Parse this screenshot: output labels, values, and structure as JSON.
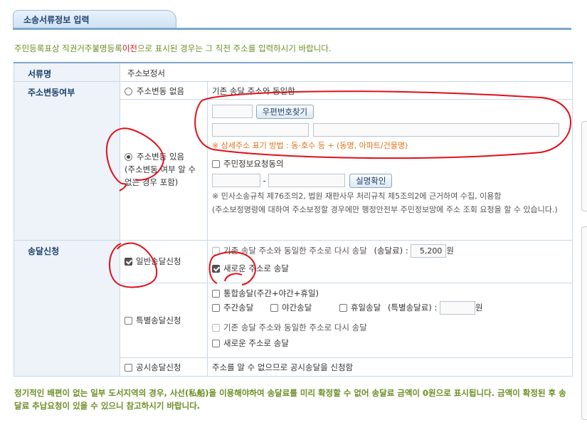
{
  "section_tab": "소송서류정보 입력",
  "notice": {
    "pre": "주민등록표상 직권거주불명등록",
    "highlight": "이전",
    "post": "으로 표시된 경우는 그 직전 주소를 입력하시기 바랍니다."
  },
  "doc_type": {
    "label": "서류명",
    "value": "주소보정서"
  },
  "address_change": {
    "label": "주소변동여부",
    "no_change": {
      "label": "주소변동 없음",
      "desc": "기존 송달 주소와 동일함"
    },
    "changed": {
      "label": "주소변동 있음",
      "sublabel": "(주소변동 여부 알 수 없는 경우 포함)"
    },
    "zip_button": "우편번호찾기",
    "address_hint": "※ 상세주소 표기 방법 : 동·호수 등 + (동명, 아파트/건물명)",
    "consent_label": "주민정보요청동의",
    "dash": "-",
    "verify_button": "실명확인",
    "law_note": "※ 민사소송규칙 제76조의2, 법원 재판사무 처리규칙 제5조의2에 근거하여 수집, 이용함",
    "law_note2": "(주소보정명령에 대하여 주소보정할 경우에만 행정안전부 주민정보망에 주소 조회 요청을 할 수 있습니다.)"
  },
  "delivery": {
    "label": "송달신청",
    "general": {
      "label": "일반송달신청",
      "same_addr": "기존 송달 주소와 동일한 주소로 다시 송달",
      "fee_label": "(송달료) :",
      "fee_value": "5,200",
      "unit": "원",
      "new_addr": "새로운 주소로 송달"
    },
    "special": {
      "label": "특별송달신청",
      "combined": "통합송달(주간+야간+휴일)",
      "day": "주간송달",
      "night": "야간송달",
      "holiday": "휴일송달",
      "fee_label": "(특별송달료) :",
      "fee_value": "",
      "unit": "원",
      "same_addr": "기존 송달 주소와 동일한 주소로 다시 송달",
      "new_addr": "새로운 주소로 송달"
    },
    "public": {
      "label": "공시송달신청",
      "desc": "주소를 알 수 없으므로 공시송달을 신청함"
    }
  },
  "footer_note": "정기적인 배편이 없는 일부 도서지역의 경우, 사선(私船)을 이용해야하여 송달료를 미리 확정할 수 없어 송달료 금액이 0원으로 표시됩니다. 금액이 확정된 후 송달료 추납요청이 있을 수 있으니 참고하시기 바랍니다.",
  "colors": {
    "accent": "#7fa6cc",
    "label_bg": "#edf3f9",
    "notice": "#6b8e23",
    "warn": "#e0731a",
    "annotation": "#e0101a"
  }
}
